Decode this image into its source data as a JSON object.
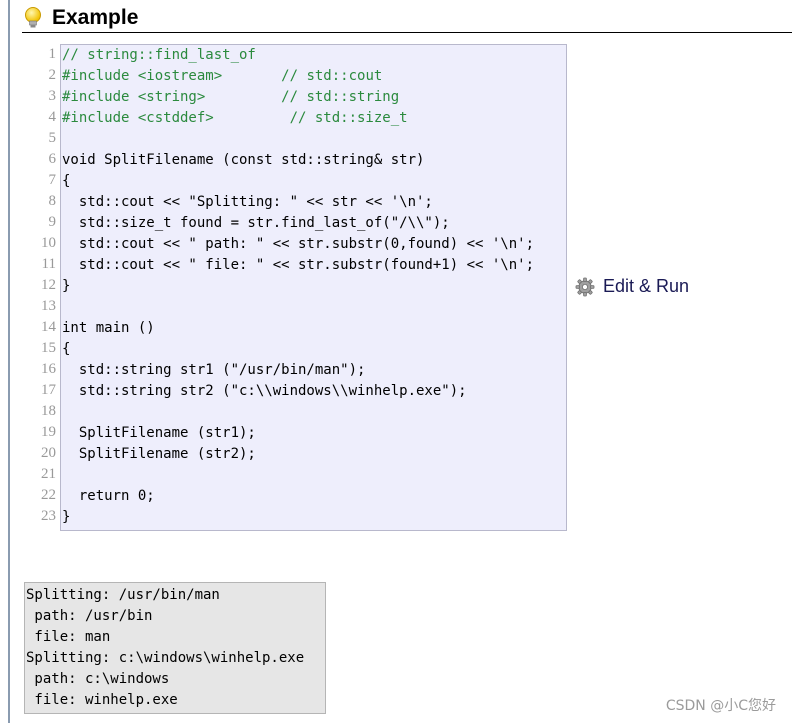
{
  "heading": {
    "title": "Example"
  },
  "code": {
    "line_numbers": [
      "1",
      "2",
      "3",
      "4",
      "5",
      "6",
      "7",
      "8",
      "9",
      "10",
      "11",
      "12",
      "13",
      "14",
      "15",
      "16",
      "17",
      "18",
      "19",
      "20",
      "21",
      "22",
      "23"
    ],
    "lines": [
      "// string::find_last_of",
      "#include <iostream>       // std::cout",
      "#include <string>         // std::string",
      "#include <cstddef>         // std::size_t",
      "",
      "void SplitFilename (const std::string& str)",
      "{",
      "  std::cout << \"Splitting: \" << str << '\\n';",
      "  std::size_t found = str.find_last_of(\"/\\\\\");",
      "  std::cout << \" path: \" << str.substr(0,found) << '\\n';",
      "  std::cout << \" file: \" << str.substr(found+1) << '\\n';",
      "}",
      "",
      "int main ()",
      "{",
      "  std::string str1 (\"/usr/bin/man\");",
      "  std::string str2 (\"c:\\\\windows\\\\winhelp.exe\");",
      "",
      "  SplitFilename (str1);",
      "  SplitFilename (str2);",
      "",
      "  return 0;",
      "}"
    ]
  },
  "edit_run": {
    "label": "Edit & Run",
    "icon": "gear-icon"
  },
  "output": {
    "lines": [
      "Splitting: /usr/bin/man",
      " path: /usr/bin",
      " file: man",
      "Splitting: c:\\windows\\winhelp.exe",
      " path: c:\\windows",
      " file: winhelp.exe"
    ]
  },
  "watermark": {
    "text": "CSDN @小C您好"
  },
  "colors": {
    "code_bg": "#eeeefc",
    "comment": "#2b8a3e",
    "output_bg": "#e6e6e6",
    "link": "#1a1a55"
  }
}
